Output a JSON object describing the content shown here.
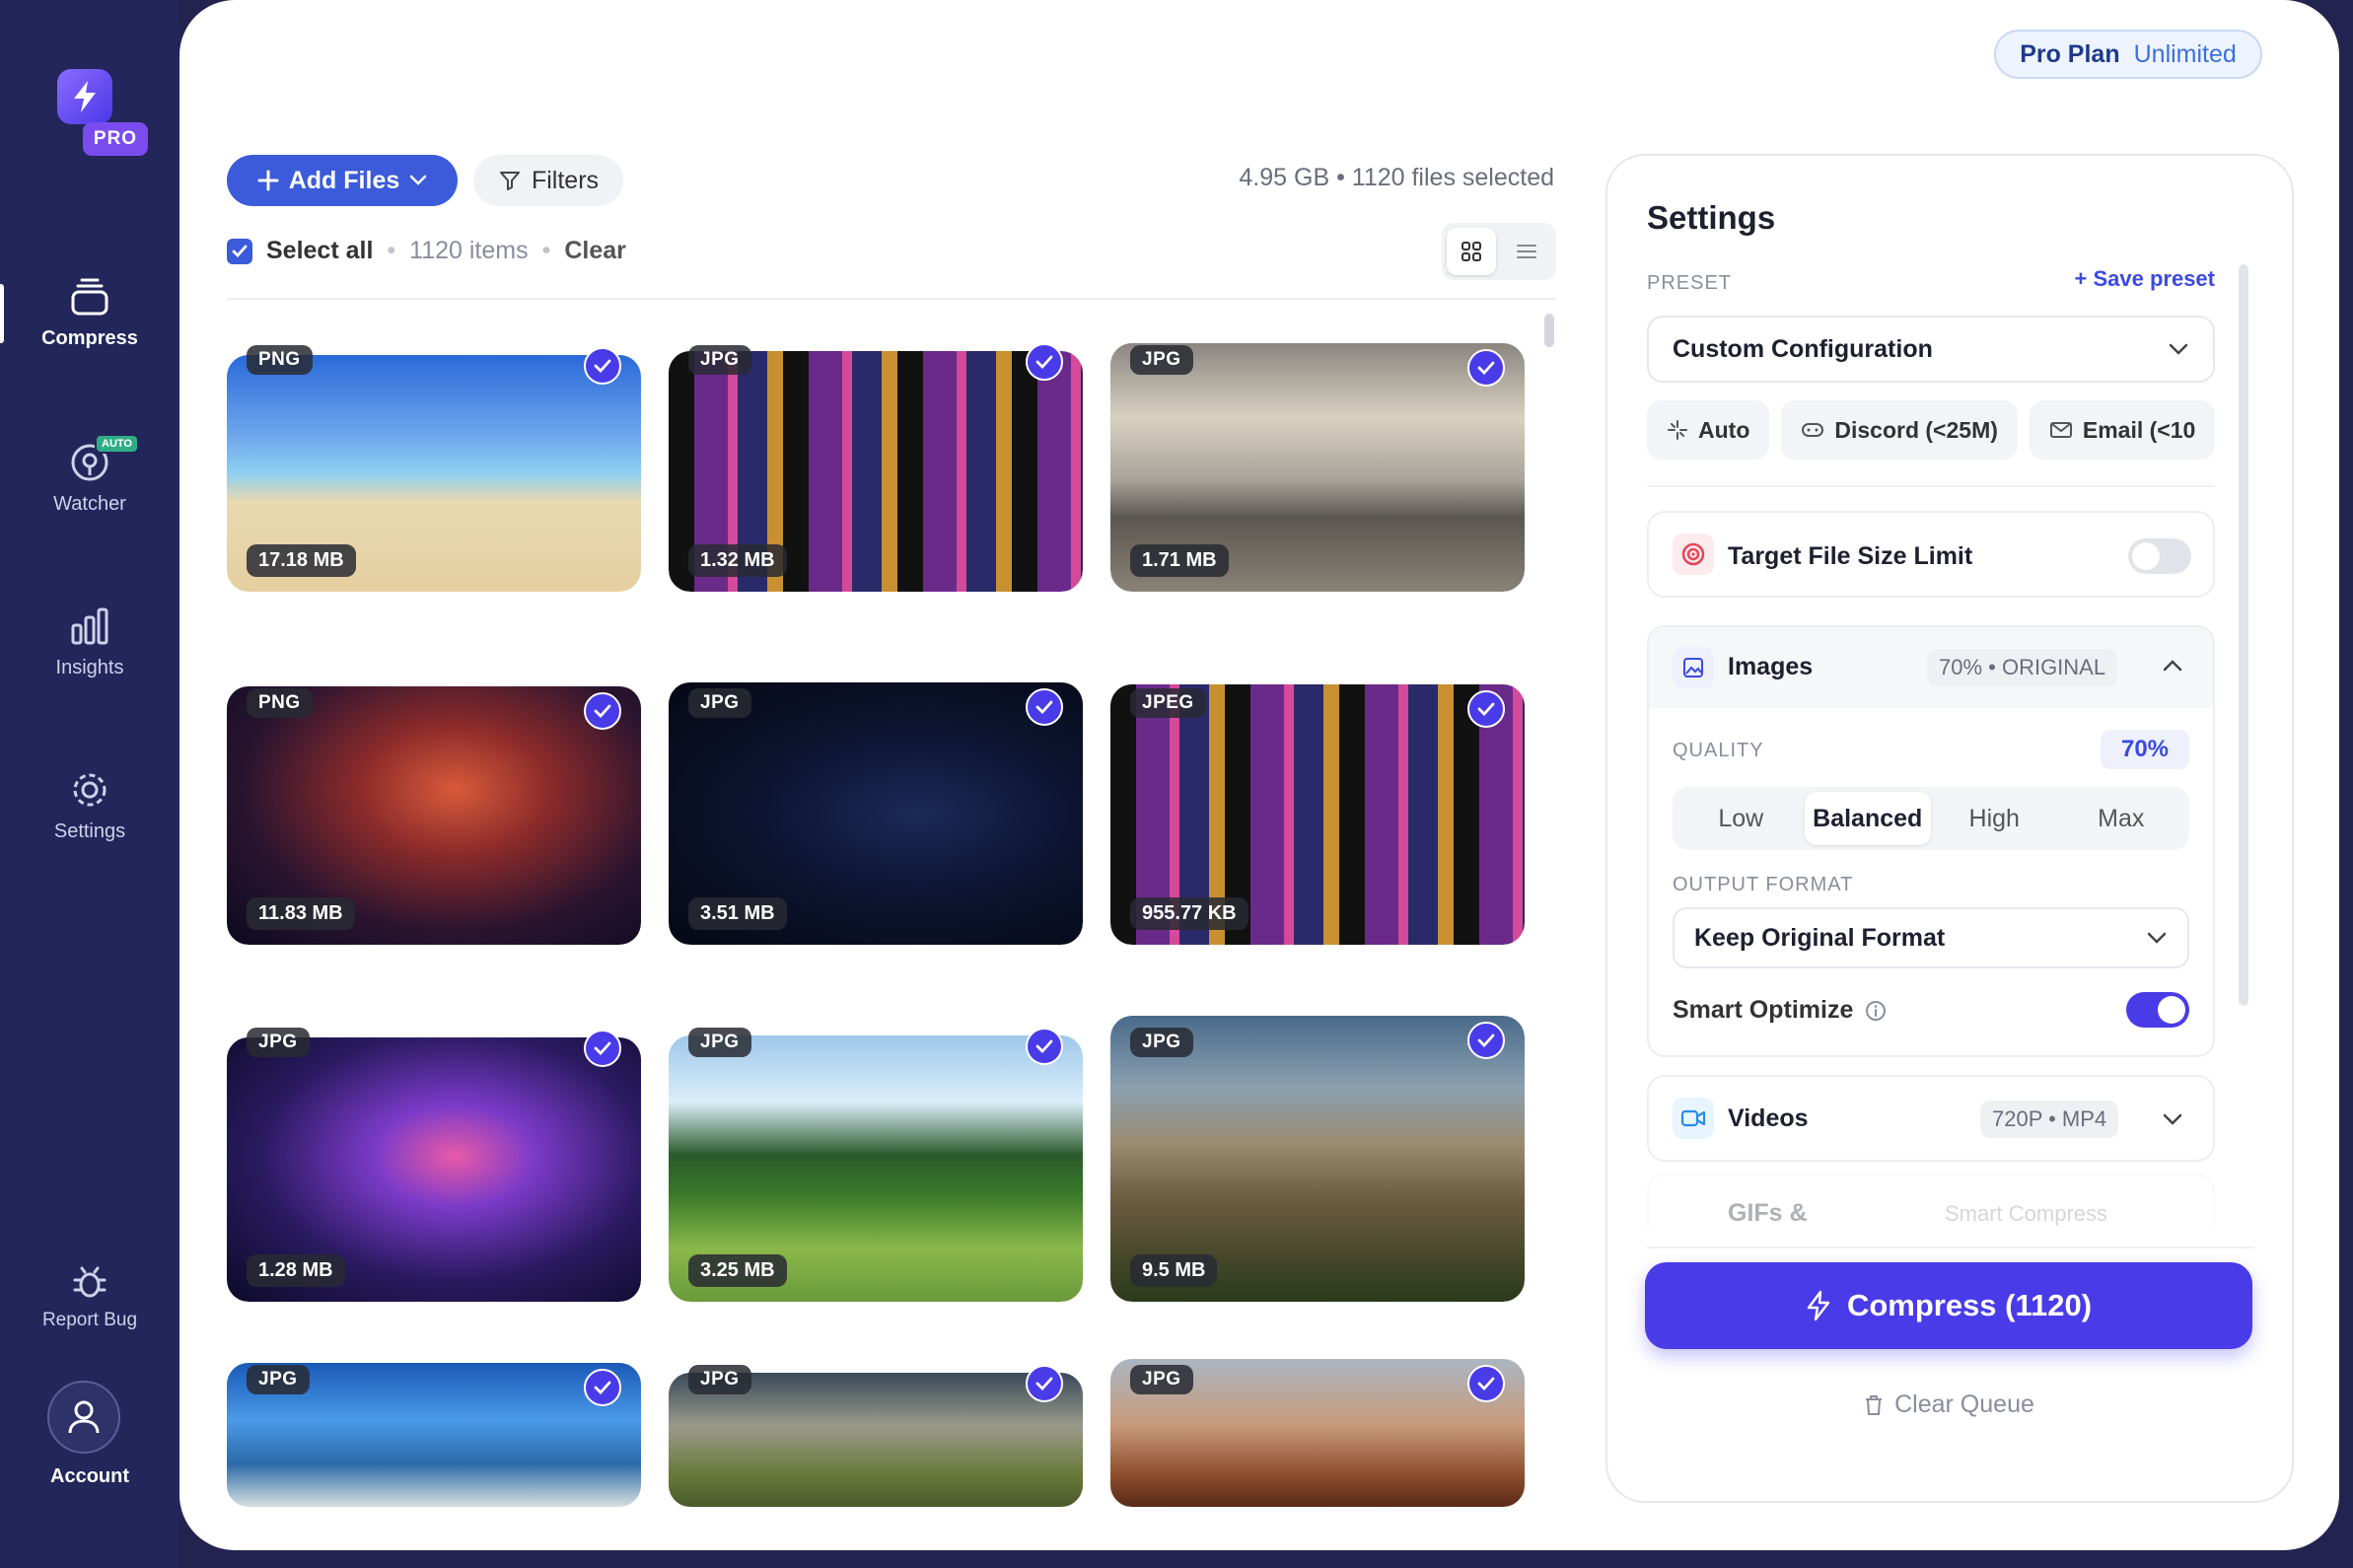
{
  "window": {
    "traffic_lights": [
      "#ff5f57",
      "#febc2e",
      "#28c840"
    ]
  },
  "sidebar": {
    "logo_badge": "PRO",
    "items": [
      {
        "label": "Compress",
        "icon": "stack-icon",
        "active": true
      },
      {
        "label": "Watcher",
        "icon": "watcher-icon",
        "badge": "AUTO"
      },
      {
        "label": "Insights",
        "icon": "bar-chart-icon"
      },
      {
        "label": "Settings",
        "icon": "gear-icon"
      }
    ],
    "report_bug": "Report Bug",
    "account": "Account"
  },
  "plan": {
    "name": "Pro Plan",
    "tier": "Unlimited"
  },
  "toolbar": {
    "add_files": "Add Files",
    "filters": "Filters",
    "summary": "4.95 GB • 1120 files selected",
    "select_all": "Select all",
    "items_count": "1120 items",
    "clear": "Clear"
  },
  "files": [
    {
      "type": "PNG",
      "size": "17.18 MB",
      "checked": true
    },
    {
      "type": "JPG",
      "size": "1.32 MB",
      "checked": true
    },
    {
      "type": "JPG",
      "size": "1.71 MB",
      "checked": true
    },
    {
      "type": "PNG",
      "size": "11.83 MB",
      "checked": true
    },
    {
      "type": "JPG",
      "size": "3.51 MB",
      "checked": true
    },
    {
      "type": "JPEG",
      "size": "955.77 KB",
      "checked": true
    },
    {
      "type": "JPG",
      "size": "1.28 MB",
      "checked": true
    },
    {
      "type": "JPG",
      "size": "3.25 MB",
      "checked": true
    },
    {
      "type": "JPG",
      "size": "9.5 MB",
      "checked": true
    },
    {
      "type": "JPG",
      "size": "",
      "checked": true
    },
    {
      "type": "JPG",
      "size": "",
      "checked": true
    },
    {
      "type": "JPG",
      "size": "",
      "checked": true
    }
  ],
  "settings": {
    "title": "Settings",
    "preset_label": "PRESET",
    "save_preset": "Save preset",
    "preset_value": "Custom Configuration",
    "quick_presets": [
      "Auto",
      "Discord (<25M)",
      "Email (<10"
    ],
    "target_limit": {
      "label": "Target File Size Limit",
      "enabled": false
    },
    "images": {
      "label": "Images",
      "summary": "70% • ORIGINAL",
      "quality_label": "QUALITY",
      "quality_value": "70%",
      "quality_options": [
        "Low",
        "Balanced",
        "High",
        "Max"
      ],
      "quality_selected": "Balanced",
      "output_label": "OUTPUT FORMAT",
      "output_value": "Keep Original Format",
      "smart_optimize": "Smart Optimize",
      "smart_enabled": true
    },
    "videos": {
      "label": "Videos",
      "summary": "720P • MP4"
    },
    "gifs": {
      "label": "GIFs &",
      "summary": "Smart Compress"
    },
    "compress_button": "Compress (1120)",
    "clear_queue": "Clear Queue"
  },
  "colors": {
    "accent": "#4a3be8",
    "blue": "#3b5bdb",
    "sidebar": "#23265a"
  }
}
